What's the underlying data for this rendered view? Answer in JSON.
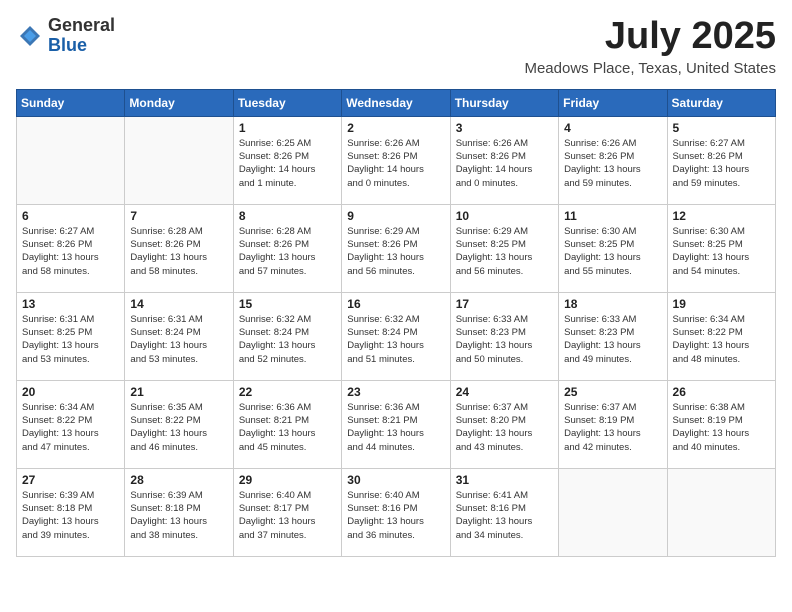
{
  "header": {
    "logo_general": "General",
    "logo_blue": "Blue",
    "month_title": "July 2025",
    "location": "Meadows Place, Texas, United States"
  },
  "weekdays": [
    "Sunday",
    "Monday",
    "Tuesday",
    "Wednesday",
    "Thursday",
    "Friday",
    "Saturday"
  ],
  "weeks": [
    [
      {
        "day": "",
        "content": ""
      },
      {
        "day": "",
        "content": ""
      },
      {
        "day": "1",
        "content": "Sunrise: 6:25 AM\nSunset: 8:26 PM\nDaylight: 14 hours\nand 1 minute."
      },
      {
        "day": "2",
        "content": "Sunrise: 6:26 AM\nSunset: 8:26 PM\nDaylight: 14 hours\nand 0 minutes."
      },
      {
        "day": "3",
        "content": "Sunrise: 6:26 AM\nSunset: 8:26 PM\nDaylight: 14 hours\nand 0 minutes."
      },
      {
        "day": "4",
        "content": "Sunrise: 6:26 AM\nSunset: 8:26 PM\nDaylight: 13 hours\nand 59 minutes."
      },
      {
        "day": "5",
        "content": "Sunrise: 6:27 AM\nSunset: 8:26 PM\nDaylight: 13 hours\nand 59 minutes."
      }
    ],
    [
      {
        "day": "6",
        "content": "Sunrise: 6:27 AM\nSunset: 8:26 PM\nDaylight: 13 hours\nand 58 minutes."
      },
      {
        "day": "7",
        "content": "Sunrise: 6:28 AM\nSunset: 8:26 PM\nDaylight: 13 hours\nand 58 minutes."
      },
      {
        "day": "8",
        "content": "Sunrise: 6:28 AM\nSunset: 8:26 PM\nDaylight: 13 hours\nand 57 minutes."
      },
      {
        "day": "9",
        "content": "Sunrise: 6:29 AM\nSunset: 8:26 PM\nDaylight: 13 hours\nand 56 minutes."
      },
      {
        "day": "10",
        "content": "Sunrise: 6:29 AM\nSunset: 8:25 PM\nDaylight: 13 hours\nand 56 minutes."
      },
      {
        "day": "11",
        "content": "Sunrise: 6:30 AM\nSunset: 8:25 PM\nDaylight: 13 hours\nand 55 minutes."
      },
      {
        "day": "12",
        "content": "Sunrise: 6:30 AM\nSunset: 8:25 PM\nDaylight: 13 hours\nand 54 minutes."
      }
    ],
    [
      {
        "day": "13",
        "content": "Sunrise: 6:31 AM\nSunset: 8:25 PM\nDaylight: 13 hours\nand 53 minutes."
      },
      {
        "day": "14",
        "content": "Sunrise: 6:31 AM\nSunset: 8:24 PM\nDaylight: 13 hours\nand 53 minutes."
      },
      {
        "day": "15",
        "content": "Sunrise: 6:32 AM\nSunset: 8:24 PM\nDaylight: 13 hours\nand 52 minutes."
      },
      {
        "day": "16",
        "content": "Sunrise: 6:32 AM\nSunset: 8:24 PM\nDaylight: 13 hours\nand 51 minutes."
      },
      {
        "day": "17",
        "content": "Sunrise: 6:33 AM\nSunset: 8:23 PM\nDaylight: 13 hours\nand 50 minutes."
      },
      {
        "day": "18",
        "content": "Sunrise: 6:33 AM\nSunset: 8:23 PM\nDaylight: 13 hours\nand 49 minutes."
      },
      {
        "day": "19",
        "content": "Sunrise: 6:34 AM\nSunset: 8:22 PM\nDaylight: 13 hours\nand 48 minutes."
      }
    ],
    [
      {
        "day": "20",
        "content": "Sunrise: 6:34 AM\nSunset: 8:22 PM\nDaylight: 13 hours\nand 47 minutes."
      },
      {
        "day": "21",
        "content": "Sunrise: 6:35 AM\nSunset: 8:22 PM\nDaylight: 13 hours\nand 46 minutes."
      },
      {
        "day": "22",
        "content": "Sunrise: 6:36 AM\nSunset: 8:21 PM\nDaylight: 13 hours\nand 45 minutes."
      },
      {
        "day": "23",
        "content": "Sunrise: 6:36 AM\nSunset: 8:21 PM\nDaylight: 13 hours\nand 44 minutes."
      },
      {
        "day": "24",
        "content": "Sunrise: 6:37 AM\nSunset: 8:20 PM\nDaylight: 13 hours\nand 43 minutes."
      },
      {
        "day": "25",
        "content": "Sunrise: 6:37 AM\nSunset: 8:19 PM\nDaylight: 13 hours\nand 42 minutes."
      },
      {
        "day": "26",
        "content": "Sunrise: 6:38 AM\nSunset: 8:19 PM\nDaylight: 13 hours\nand 40 minutes."
      }
    ],
    [
      {
        "day": "27",
        "content": "Sunrise: 6:39 AM\nSunset: 8:18 PM\nDaylight: 13 hours\nand 39 minutes."
      },
      {
        "day": "28",
        "content": "Sunrise: 6:39 AM\nSunset: 8:18 PM\nDaylight: 13 hours\nand 38 minutes."
      },
      {
        "day": "29",
        "content": "Sunrise: 6:40 AM\nSunset: 8:17 PM\nDaylight: 13 hours\nand 37 minutes."
      },
      {
        "day": "30",
        "content": "Sunrise: 6:40 AM\nSunset: 8:16 PM\nDaylight: 13 hours\nand 36 minutes."
      },
      {
        "day": "31",
        "content": "Sunrise: 6:41 AM\nSunset: 8:16 PM\nDaylight: 13 hours\nand 34 minutes."
      },
      {
        "day": "",
        "content": ""
      },
      {
        "day": "",
        "content": ""
      }
    ]
  ]
}
